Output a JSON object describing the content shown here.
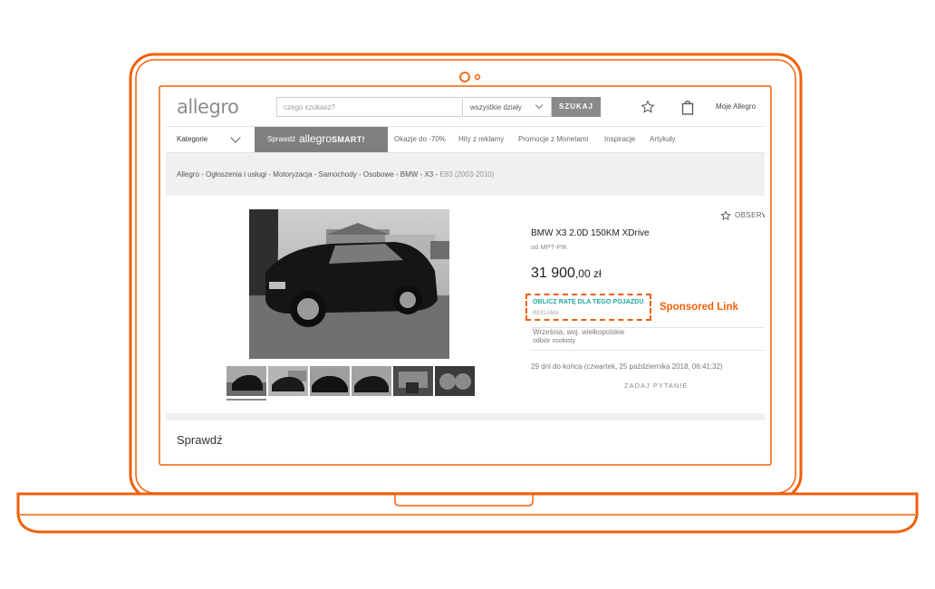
{
  "colors": {
    "frame_orange": "#f1600a",
    "ad_teal": "#1ea7a0"
  },
  "header": {
    "logo": "allegro",
    "search_placeholder": "czego szukasz?",
    "category_select": "wszystkie działy",
    "search_button": "SZUKAJ",
    "my_allegro": "Moje Allegro",
    "icons": [
      "star-icon",
      "bag-icon"
    ]
  },
  "nav": {
    "categories": "Kategorie",
    "smart_prefix": "Sprawdź",
    "smart_brand": "allegro",
    "smart_brand_suffix": "SMART!",
    "links": [
      "Okazje do -70%",
      "Hity z reklamy",
      "Promocje z Monetami",
      "Inspiracje",
      "Artykuły"
    ]
  },
  "breadcrumb": [
    "Allegro",
    "Ogłoszenia i usługi",
    "Motoryzacja",
    "Samochody",
    "Osobowe",
    "BMW",
    "X3",
    "E83 (2003-2010)"
  ],
  "listing": {
    "observe": "OBSERW",
    "title": "BMW X3 2.0D 150KM XDrive",
    "seller": "od MPT-PIK",
    "price_main": "31 900",
    "price_fraction": ",00 zł",
    "ad_link": "OBLICZ RATĘ DLA TEGO POJAZDU",
    "ad_label": "REKLAMA",
    "location": "Września, woj. wielkopolskie",
    "pickup": "odbiór osobisty",
    "ends": "29 dni do końca (czwartek, 25 października 2018, 06:41:32)",
    "ask": "ZADAJ PYTANIE",
    "thumbnail_count": 6
  },
  "annotation": {
    "sponsored": "Sponsored Link"
  },
  "section": {
    "check": "Sprawdź"
  }
}
